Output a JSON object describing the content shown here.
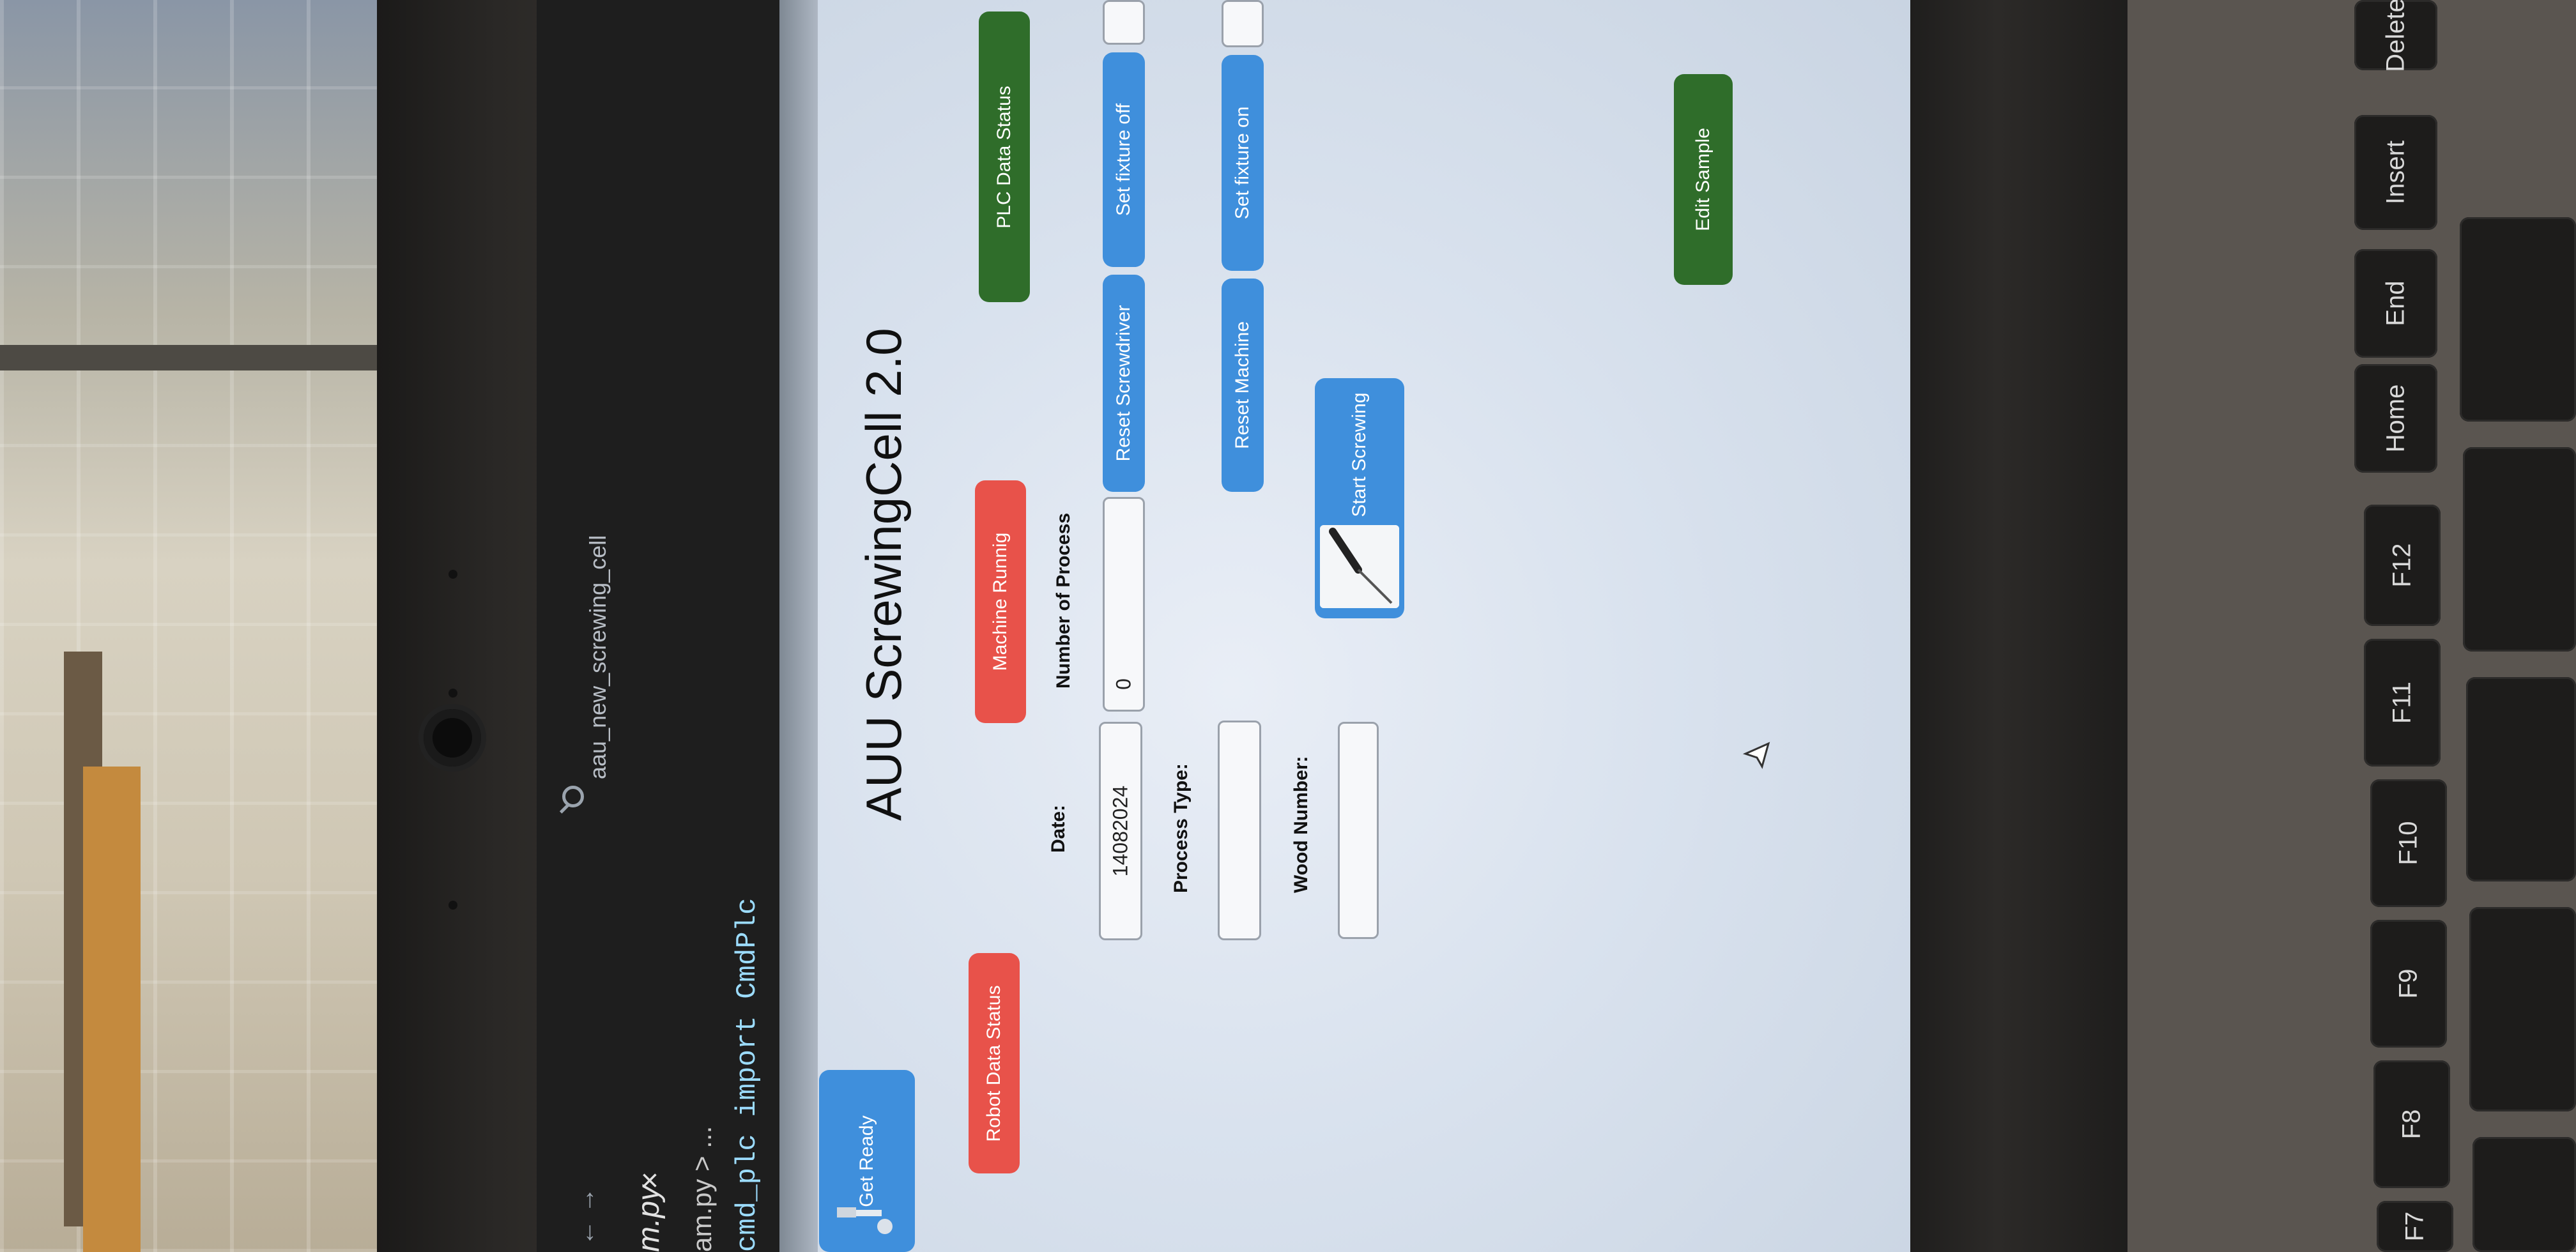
{
  "editor": {
    "search_text": "aau_new_screwing_cell",
    "tab_label": "m.py",
    "tab_close": "×",
    "breadcrumb": "am.py > ...",
    "code_line": "cmd_plc import CmdPlc",
    "nav_arrows": "← →"
  },
  "app": {
    "title": "AUU ScrewingCell 2.0",
    "buttons": {
      "get_ready": "Get Ready",
      "robot_data_status": "Robot Data Status",
      "machine_running": "Machine Runnig",
      "plc_data_status": "PLC Data Status",
      "reset_screwdriver": "Reset Screwdriver",
      "set_fixture_off": "Set fixture off",
      "reset_machine": "Reset Machine",
      "set_fixture_on": "Set fixture on",
      "start_screwing": "Start Screwing",
      "edit_sample": "Edit Sample"
    },
    "fields": {
      "date_label": "Date:",
      "date_value": "14082024",
      "process_count_label": "Number of Process",
      "process_count_value": "0",
      "process_type_label": "Process Type:",
      "process_type_value": "",
      "wood_number_label": "Wood Number:",
      "wood_number_value": ""
    },
    "colors": {
      "blue_button": "#3f8fdc",
      "red_button": "#e8524a",
      "green_button": "#2f6d2a"
    }
  },
  "keyboard": {
    "keys": [
      "Delete",
      "Insert",
      "End",
      "Home",
      "F12",
      "F11",
      "F10",
      "F9",
      "F8",
      "F7"
    ]
  }
}
